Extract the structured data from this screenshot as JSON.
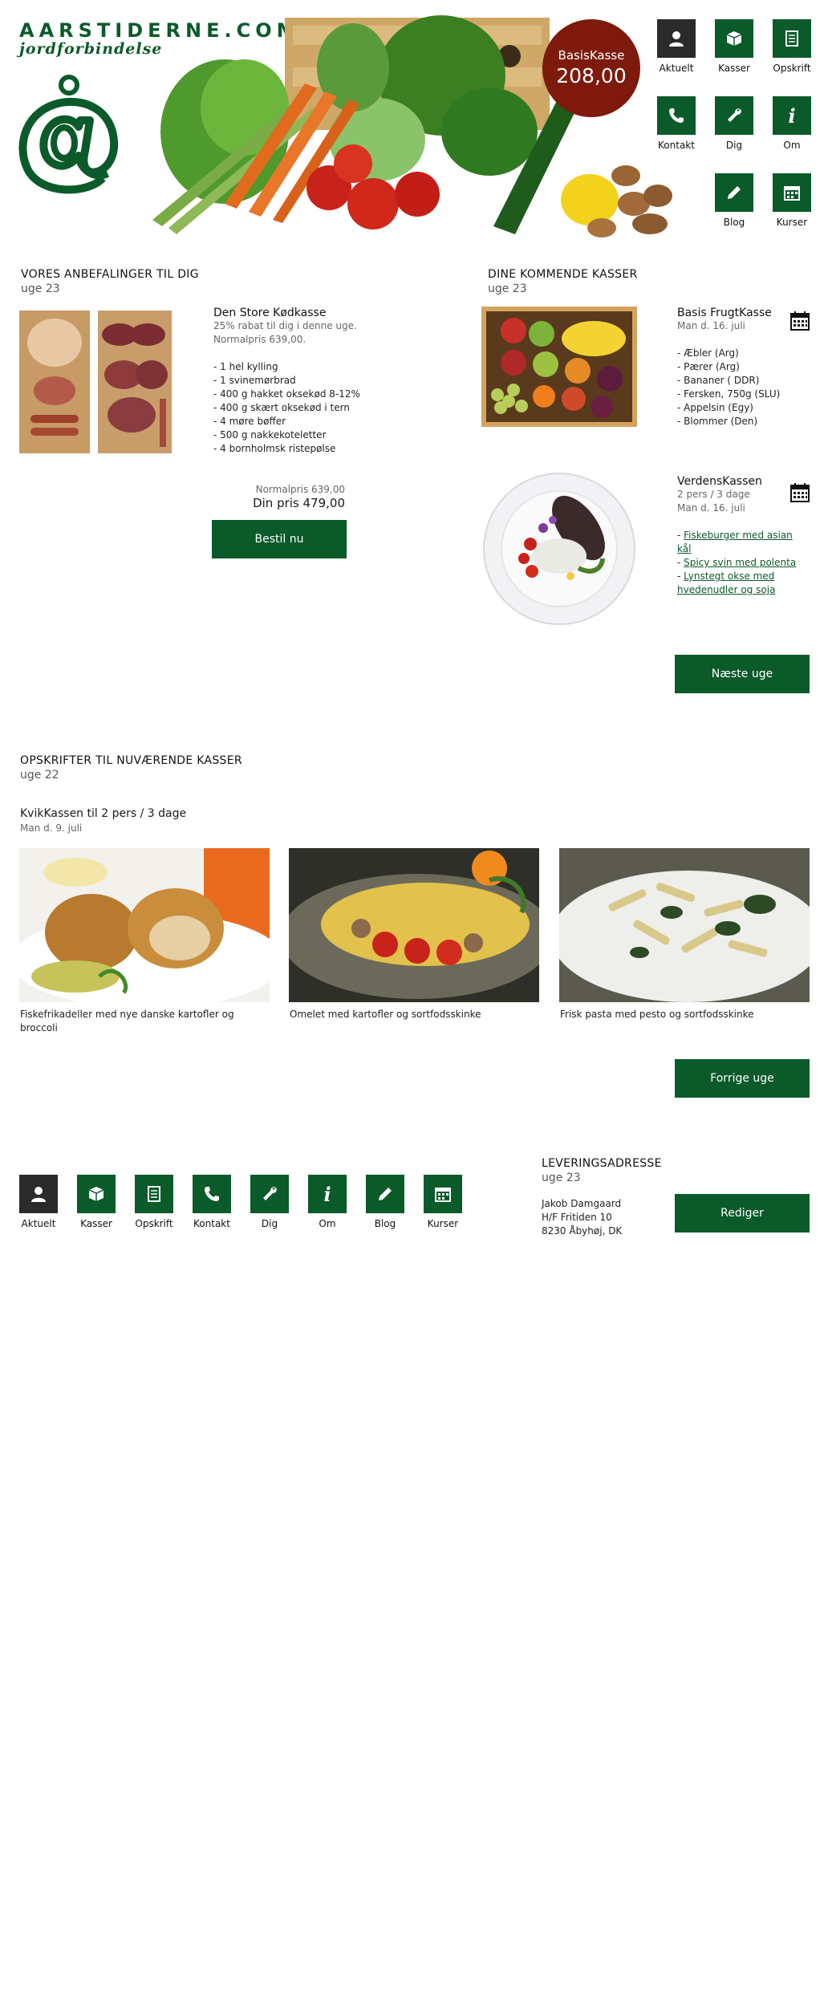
{
  "brand": {
    "name": "AARSTIDERNE.COM",
    "tagline": "jordforbindelse",
    "at_symbol": "å"
  },
  "hero": {
    "box_name": "BasisKasse",
    "box_price": "208,00"
  },
  "nav_top": [
    {
      "label": "Aktuelt",
      "icon": "user-icon",
      "active": true
    },
    {
      "label": "Kasser",
      "icon": "box-icon"
    },
    {
      "label": "Opskrift",
      "icon": "recipe-icon"
    },
    {
      "label": "Kontakt",
      "icon": "phone-icon"
    },
    {
      "label": "Dig",
      "icon": "wrench-icon"
    },
    {
      "label": "Om",
      "icon": "info-icon"
    },
    {
      "label": "Blog",
      "icon": "pencil-icon"
    },
    {
      "label": "Kurser",
      "icon": "calendar-icon"
    }
  ],
  "recommendations": {
    "title": "VORES ANBEFALINGER TIL DIG",
    "week": "uge 23",
    "product_name": "Den Store Kødkasse",
    "discount_text": "25% rabat til dig i denne uge.",
    "normal_price_line": "Normalpris 639,00.",
    "items": [
      "- 1 hel kylling",
      "- 1 svinemørbrad",
      "- 400 g hakket oksekød 8-12%",
      "- 400 g skært oksekød i tern",
      "- 4 møre bøffer",
      "- 500 g nakkekoteletter",
      "- 4 bornholmsk ristepølse"
    ],
    "normal_price": "Normalpris 639,00",
    "your_price": "Din pris 479,00",
    "order_button": "Bestil nu"
  },
  "upcoming": {
    "title": "DINE KOMMENDE KASSER",
    "week": "uge 23",
    "boxes": [
      {
        "name": "Basis FrugtKasse",
        "date": "Man d. 16. juli",
        "items": [
          "- Æbler (Arg)",
          "- Pærer (Arg)",
          "- Bananer ( DDR)",
          "- Fersken, 750g (SLU)",
          "- Appelsin (Egy)",
          "- Blommer (Den)"
        ]
      },
      {
        "name": "VerdensKassen",
        "servings": "2 pers / 3 dage",
        "date": "Man d. 16. juli",
        "links": [
          "Fiskeburger med asian kål",
          "Spicy svin med polenta",
          "Lynstegt okse med hvedenudler og soja"
        ]
      }
    ],
    "next_button": "Næste uge"
  },
  "recipes": {
    "title": "OPSKRIFTER TIL NUVÆRENDE KASSER",
    "week": "uge 22",
    "box_name": "KvikKassen til 2 pers / 3 dage",
    "box_date": "Man d. 9. juli",
    "items": [
      "Fiskefrikadeller med nye danske kartofler og broccoli",
      "Omelet med kartofler og sortfodsskinke",
      "Frisk pasta med pesto og sortfodsskinke"
    ],
    "prev_button": "Forrige uge"
  },
  "delivery": {
    "title": "LEVERINGSADRESSE",
    "week": "uge 23",
    "address_lines": [
      "Jakob Damgaard",
      "H/F Fritiden 10",
      "8230 Åbyhøj, DK"
    ],
    "edit_button": "Rediger"
  },
  "colors": {
    "brand_green": "#0b5a2a",
    "price_circle": "#7d1a0c",
    "active_nav": "#2a2a2a"
  }
}
